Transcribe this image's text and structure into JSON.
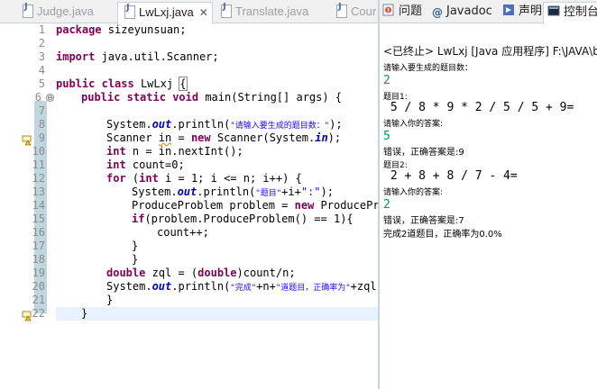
{
  "editor": {
    "tabs": [
      {
        "label": "Judge.java"
      },
      {
        "label": "LwLxj.java",
        "active": true
      },
      {
        "label": "Translate.java"
      },
      {
        "label": "Cour"
      }
    ],
    "close_glyph": "✕",
    "line_numbers": [
      "1",
      "2",
      "3",
      "4",
      "5",
      "6",
      "7",
      "8",
      "9",
      "10",
      "11",
      "12",
      "13",
      "14",
      "15",
      "16",
      "17",
      "18",
      "19",
      "20",
      "21",
      "22"
    ],
    "fold_marker": "⊖"
  },
  "views": {
    "tabs": [
      {
        "label": "问题",
        "icon": "problems-icon"
      },
      {
        "label": "Javadoc",
        "icon": "at-icon"
      },
      {
        "label": "声明",
        "icon": "declaration-icon"
      },
      {
        "label": "控制台",
        "icon": "console-icon",
        "active": true
      }
    ],
    "console": {
      "header": "<已终止> LwLxj [Java 应用程序] F:\\JAVA\\bi",
      "lines": [
        {
          "text": "请输入要生成的题目数：",
          "type": "out"
        },
        {
          "text": "2",
          "type": "in"
        },
        {
          "text": "题目1:",
          "type": "out"
        },
        {
          "text": " 5 / 8 * 9 * 2 / 5 / 5 + 9=",
          "type": "mono"
        },
        {
          "text": "请输入你的答案:",
          "type": "out"
        },
        {
          "text": "5",
          "type": "in"
        },
        {
          "text": "错误，正确答案是:9",
          "type": "out"
        },
        {
          "text": "题目2:",
          "type": "out"
        },
        {
          "text": " 2 + 8 + 8 / 7 - 4=",
          "type": "mono"
        },
        {
          "text": "请输入你的答案:",
          "type": "out"
        },
        {
          "text": "2",
          "type": "in"
        },
        {
          "text": "错误，正确答案是:7",
          "type": "out"
        },
        {
          "text": "完成2道题目，正确率为0.0%",
          "type": "out"
        }
      ]
    }
  },
  "code": {
    "l1": {
      "kw": "package",
      "rest": " sizeyunsuan;"
    },
    "l3": {
      "kw": "import",
      "rest": " java.util.Scanner;"
    },
    "l5": {
      "kw1": "public",
      "kw2": "class",
      "name": " LwLxj ",
      "brace": "{"
    },
    "l6": {
      "kw1": "public",
      "kw2": "static",
      "kw3": "void",
      "rest": " main(String[] args) {"
    },
    "l8": {
      "a": "System.",
      "fld": "out",
      "b": ".println(",
      "str": "\"请输入要生成的题目数：\"",
      "c": ");"
    },
    "l9": {
      "a": "Scanner ",
      "var": "in",
      "b": " = ",
      "kw": "new",
      "c": " Scanner(System.",
      "fld": "in",
      "d": ");"
    },
    "l10": {
      "kw": "int",
      "rest": " n = in.nextInt();"
    },
    "l11": {
      "kw": "int",
      "rest": " count=0;"
    },
    "l12": {
      "kw1": "for",
      "a": " (",
      "kw2": "int",
      "rest": " i = 1; i <= n; i++) {"
    },
    "l13": {
      "a": "System.",
      "fld": "out",
      "b": ".println(",
      "str1": "\"题目\"",
      "c": "+i+",
      "str2": "\":\"",
      "d": ");"
    },
    "l14": {
      "a": "ProduceProblem problem = ",
      "kw": "new",
      "b": " ProducePro"
    },
    "l15": {
      "kw": "if",
      "rest": "(problem.ProduceProblem() == 1){"
    },
    "l16": {
      "rest": "count++;"
    },
    "l17": {
      "rest": "}"
    },
    "l18": {
      "rest": "}"
    },
    "l19": {
      "kw1": "double",
      "a": " zql = (",
      "kw2": "double",
      "b": ")count/n;"
    },
    "l20": {
      "a": "System.",
      "fld": "out",
      "b": ".println(",
      "str1": "\"完成\"",
      "c": "+n+",
      "str2": "\"道题目，正确率为\"",
      "d": "+zql"
    },
    "l21": {
      "rest": "}"
    },
    "l22": {
      "rest": "}"
    }
  }
}
